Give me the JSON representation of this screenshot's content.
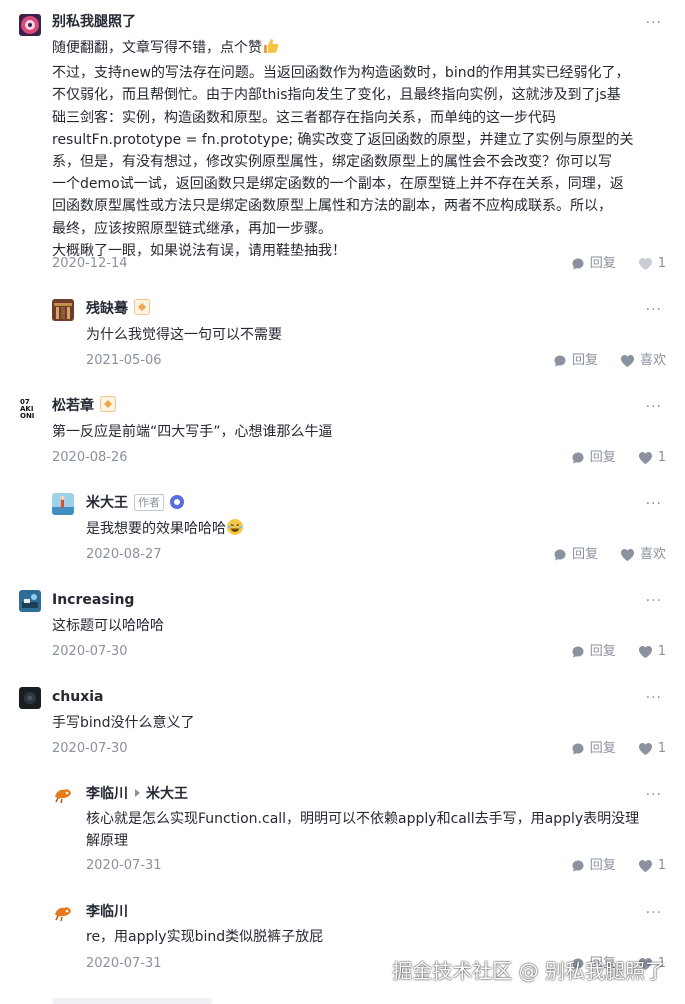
{
  "more_label": "···",
  "reply_label": "回复",
  "like_label": "喜欢",
  "comments": [
    {
      "author": "别私我腿照了",
      "lines": [
        "随便翻翻，文章写得不错，点个赞",
        "不过，支持new的写法存在问题。当返回函数作为构造函数时，bind的作用其实已经弱化了，",
        "不仅弱化，而且帮倒忙。由于内部this指向发生了变化，且最终指向实例，这就涉及到了js基",
        "础三剑客：实例，构造函数和原型。这三者都存在指向关系，而单纯的这一步代码",
        "resultFn.prototype = fn.prototype; 确实改变了返回函数的原型，并建立了实例与原型的关",
        "系，但是，有没有想过，修改实例原型属性，绑定函数原型上的属性会不会改变？你可以写",
        "一个demo试一试，返回函数只是绑定函数的一个副本，在原型链上并不存在关系，同理，返",
        "回函数原型属性或方法只是绑定函数原型上属性和方法的副本，两者不应构成联系。所以，",
        "最终，应该按照原型链式继承，再加一步骤。",
        "大概瞅了一眼，如果说法有误，请用鞋垫抽我！"
      ],
      "date": "2020-12-14",
      "like": "1"
    },
    {
      "author": "残缺蓦",
      "lines": [
        "为什么我觉得这一句可以不需要"
      ],
      "date": "2021-05-06",
      "like": "喜欢"
    },
    {
      "author": "松若章",
      "lines": [
        "第一反应是前端“四大写手”，心想谁那么牛逼"
      ],
      "date": "2020-08-26",
      "like": "1"
    },
    {
      "author": "米大王",
      "tag": "作者",
      "lines": [
        "是我想要的效果哈哈哈"
      ],
      "date": "2020-08-27",
      "like": "喜欢"
    },
    {
      "author": "Increasing",
      "lines": [
        "这标题可以哈哈哈"
      ],
      "date": "2020-07-30",
      "like": "1"
    },
    {
      "author": "chuxia",
      "lines": [
        "手写bind没什么意义了"
      ],
      "date": "2020-07-30",
      "like": "1"
    },
    {
      "author": "李临川",
      "reply_to": "米大王",
      "lines": [
        "核心就是怎么实现Function.call，明明可以不依赖apply和call去手写，用apply表明没理",
        "解原理"
      ],
      "date": "2020-07-31",
      "like": "1"
    },
    {
      "author": "李临川",
      "lines": [
        "re，用apply实现bind类似脱裤子放屁"
      ],
      "date": "2020-07-31",
      "like": "1"
    }
  ],
  "watermark": "掘金技术社区 @ 别私我腿照了",
  "colors": {
    "text": "#252933",
    "muted": "#8a919f",
    "badge": "#f0a64b",
    "verified": "#5b6be0"
  }
}
